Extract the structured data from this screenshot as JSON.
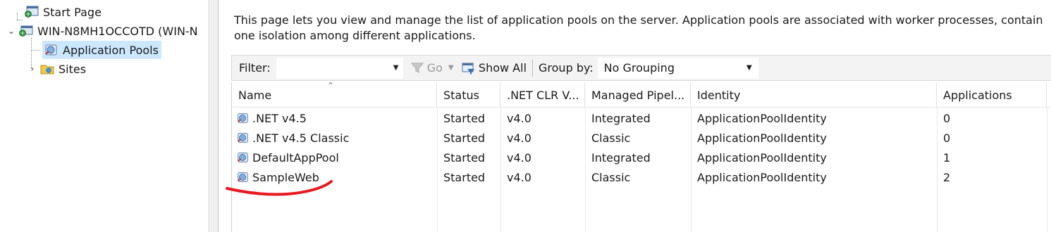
{
  "tree": {
    "items": [
      {
        "label": "Start Page",
        "icon": "start-page-icon"
      },
      {
        "label": "WIN-N8MH1OCCOTD (WIN-N",
        "icon": "server-icon",
        "expander": "expanded"
      },
      {
        "label": "Application Pools",
        "icon": "app-pool-icon",
        "selected": true
      },
      {
        "label": "Sites",
        "icon": "sites-folder-icon",
        "expander": "collapsed"
      }
    ]
  },
  "description": "This page lets you view and manage the list of application pools on the server. Application pools are associated with worker processes, contain one isolation among different applications.",
  "toolbar": {
    "filter_label": "Filter:",
    "filter_value": "",
    "go_label": "Go",
    "show_all_label": "Show All",
    "group_by_label": "Group by:",
    "group_by_value": "No Grouping"
  },
  "grid": {
    "columns": [
      "Name",
      "Status",
      ".NET CLR V...",
      "Managed Pipel...",
      "Identity",
      "Applications"
    ],
    "rows": [
      {
        "name": ".NET v4.5",
        "status": "Started",
        "clr": "v4.0",
        "pipeline": "Integrated",
        "identity": "ApplicationPoolIdentity",
        "applications": "0"
      },
      {
        "name": ".NET v4.5 Classic",
        "status": "Started",
        "clr": "v4.0",
        "pipeline": "Classic",
        "identity": "ApplicationPoolIdentity",
        "applications": "0"
      },
      {
        "name": "DefaultAppPool",
        "status": "Started",
        "clr": "v4.0",
        "pipeline": "Integrated",
        "identity": "ApplicationPoolIdentity",
        "applications": "1"
      },
      {
        "name": "SampleWeb",
        "status": "Started",
        "clr": "v4.0",
        "pipeline": "Classic",
        "identity": "ApplicationPoolIdentity",
        "applications": "2"
      }
    ]
  },
  "colors": {
    "selection": "#cce8ff",
    "annotation": "#e8191e",
    "toolbar_bg": "#f3f3f3"
  }
}
